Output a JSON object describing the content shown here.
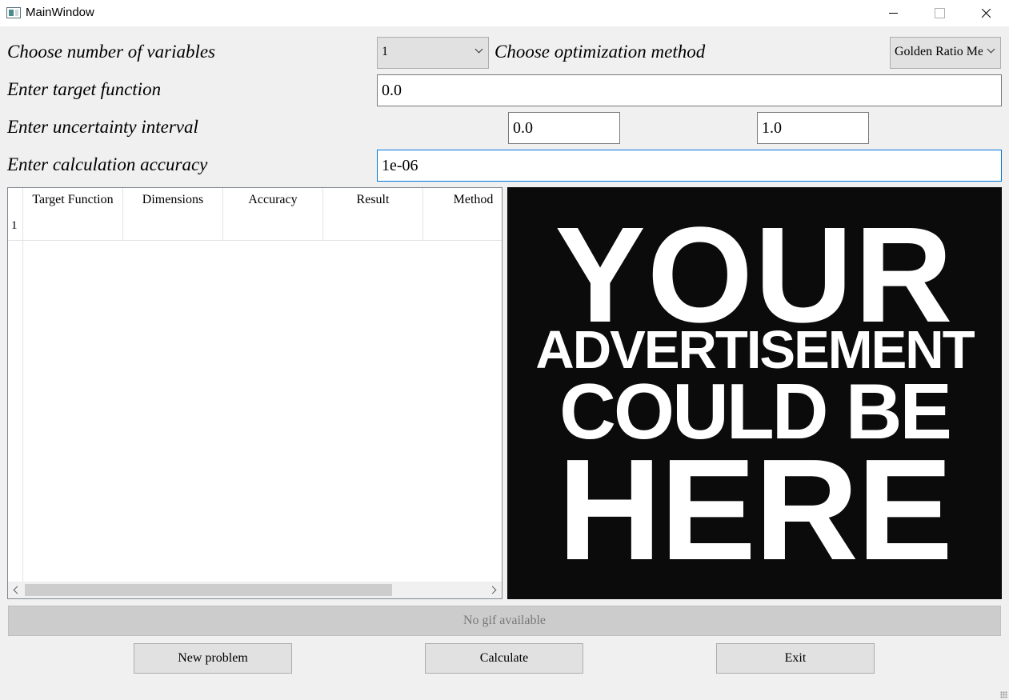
{
  "window": {
    "title": "MainWindow"
  },
  "form": {
    "variables_label": "Choose number of variables",
    "variables_value": "1",
    "method_label": "Choose optimization method",
    "method_value": "Golden Ratio Me",
    "function_label": "Enter target function",
    "function_value": "0.0",
    "interval_label": "Enter uncertainty interval",
    "interval_from": "0.0",
    "interval_to": "1.0",
    "accuracy_label": "Enter calculation accuracy",
    "accuracy_value": "1e-06"
  },
  "table": {
    "columns": [
      "Target Function",
      "Dimensions",
      "Accuracy",
      "Result",
      "Method"
    ],
    "rows": [
      "1"
    ]
  },
  "advertisement": {
    "lines": [
      "YOUR",
      "ADVERTISEMENT",
      "COULD BE",
      "HERE"
    ],
    "background": "#0b0b0b",
    "text_color": "#ffffff"
  },
  "gif_status": "No gif available",
  "buttons": {
    "new_problem": "New problem",
    "calculate": "Calculate",
    "exit": "Exit"
  },
  "colors": {
    "focus_border": "#0078d7",
    "window_bg": "#f0f0f0"
  }
}
